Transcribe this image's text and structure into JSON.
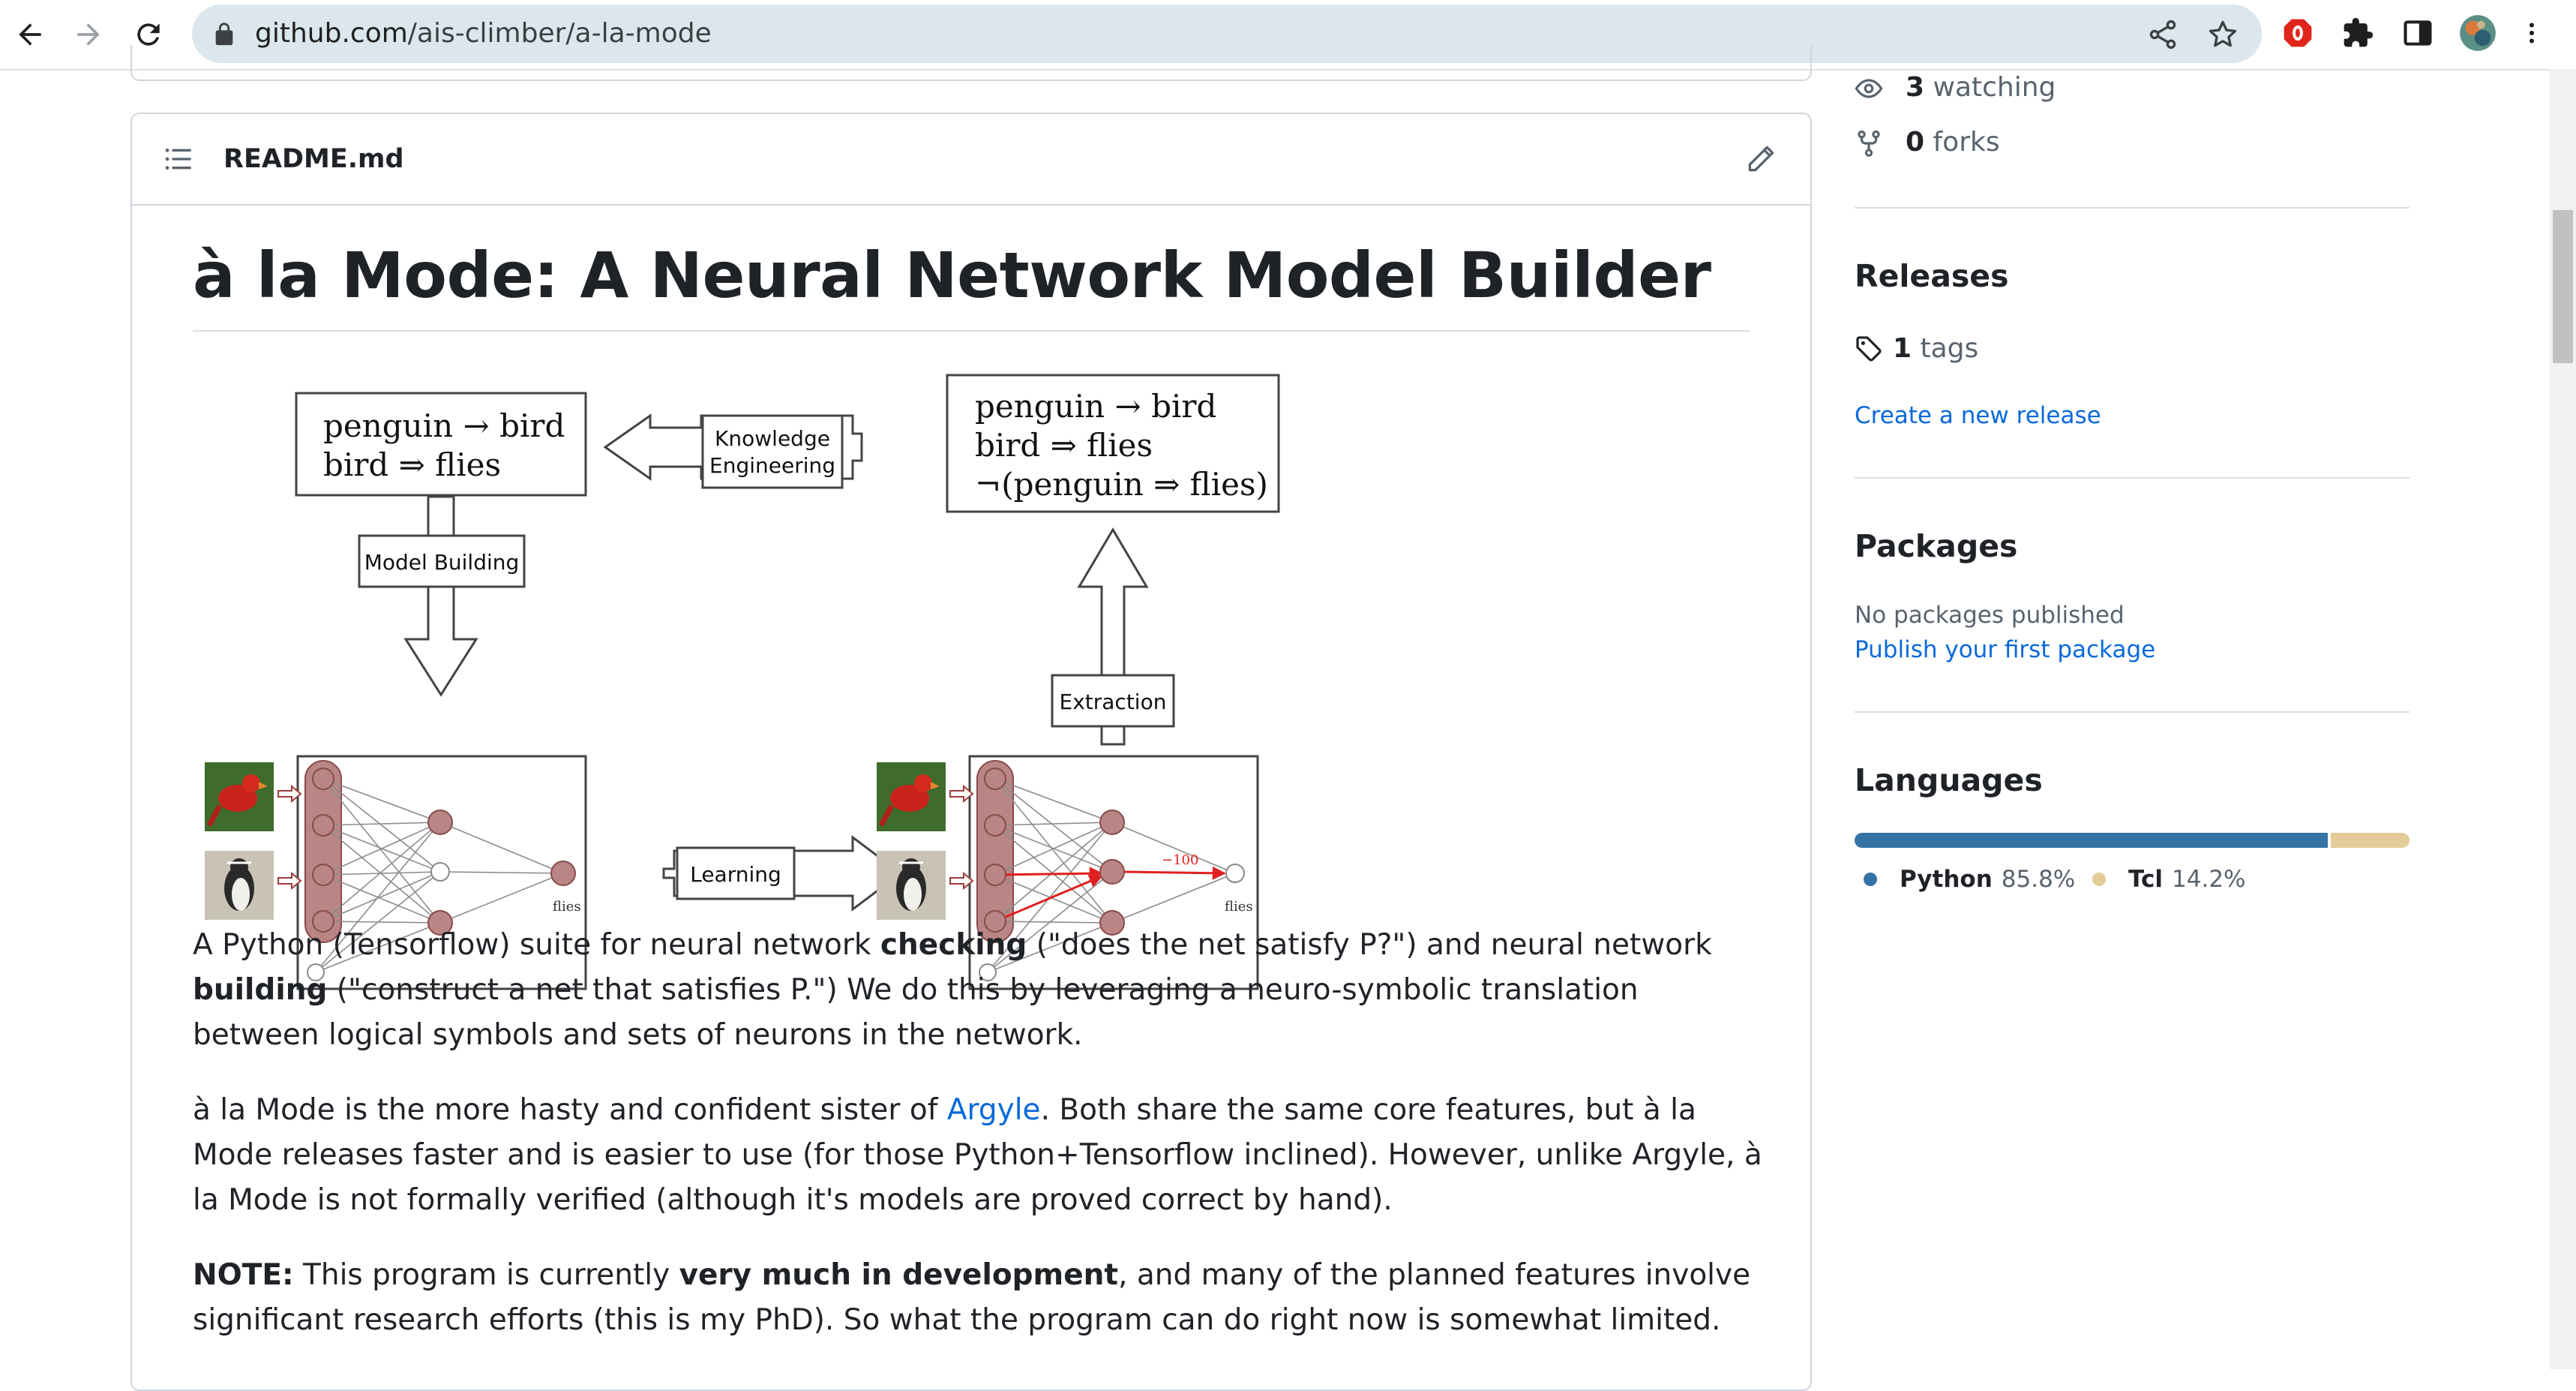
{
  "browser": {
    "url_host": "github.com",
    "url_path": "/ais-climber/a-la-mode",
    "icons": [
      "back-icon",
      "forward-icon",
      "reload-icon",
      "lock-icon",
      "share-icon",
      "star-icon",
      "adblock-icon",
      "extensions-icon",
      "side-panel-icon",
      "profile-avatar",
      "menu-icon"
    ]
  },
  "readme": {
    "filename": "README.md",
    "title": "à la Mode: A Neural Network Model Builder",
    "figure": {
      "top_left_box": [
        "penguin → bird",
        "bird ⇒ flies"
      ],
      "top_right_box": [
        "penguin → bird",
        "bird ⇒ flies",
        "¬(penguin ⇒ flies)"
      ],
      "knowledge_engineering": [
        "Knowledge",
        "Engineering"
      ],
      "model_building": "Model Building",
      "extraction": "Extraction",
      "learning": "Learning",
      "flies": "flies",
      "weight": "−100"
    },
    "p1": {
      "t1": "A Python (Tensorflow) suite for neural network ",
      "b1": "checking",
      "t2": " (\"does the net satisfy P?\") and neural network ",
      "b2": "building",
      "t3": " (\"construct a net that satisfies P.\") We do this by leveraging a neuro-symbolic translation between logical symbols and sets of neurons in the network."
    },
    "p2": {
      "t1": "à la Mode is the more hasty and confident sister of ",
      "link": "Argyle",
      "t2": ". Both share the same core features, but à la Mode releases faster and is easier to use (for those Python+Tensorflow inclined). However, unlike Argyle, à la Mode is not formally verified (although it's models are proved correct by hand)."
    },
    "p3": {
      "b1": "NOTE:",
      "t1": " This program is currently ",
      "b2": "very much in development",
      "t2": ", and many of the planned features involve significant research efforts (this is my PhD). So what the program can do right now is somewhat limited."
    }
  },
  "sidebar": {
    "watching_count": "3",
    "watching_label": " watching",
    "forks_count": "0",
    "forks_label": " forks",
    "releases_heading": "Releases",
    "tags_count": "1",
    "tags_label": " tags",
    "create_release": "Create a new release",
    "packages_heading": "Packages",
    "no_packages": "No packages published",
    "publish_package": "Publish your first package",
    "languages_heading": "Languages",
    "languages": [
      {
        "name": "Python",
        "percent": "85.8%",
        "value": 85.8,
        "color": "#3572A5"
      },
      {
        "name": "Tcl",
        "percent": "14.2%",
        "value": 14.2,
        "color": "#e4cc98"
      }
    ]
  }
}
